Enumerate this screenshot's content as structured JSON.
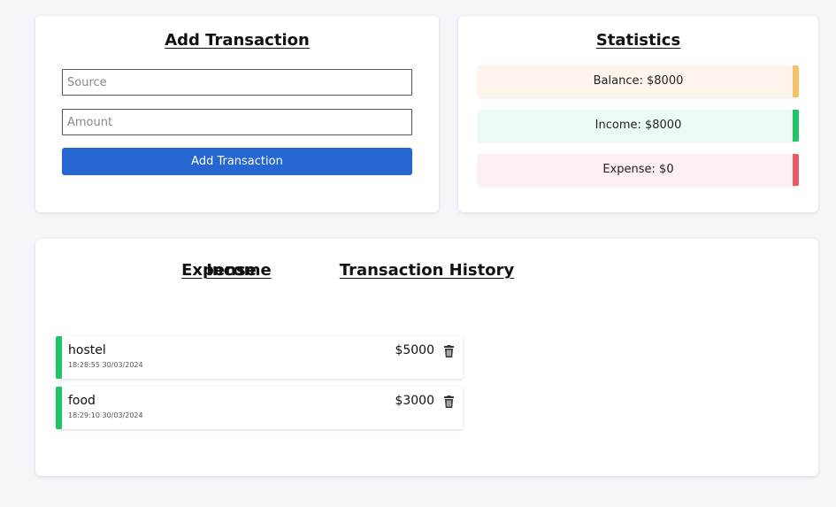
{
  "add_transaction": {
    "title": "Add Transaction",
    "source_placeholder": "Source",
    "amount_placeholder": "Amount",
    "button_label": "Add Transaction"
  },
  "statistics": {
    "title": "Statistics",
    "balance": "Balance: $8000",
    "income": "Income: $8000",
    "expense": "Expense: $0",
    "colors": {
      "balance": "#f5c26a",
      "income": "#22c46a",
      "expense": "#e85a6a"
    }
  },
  "history": {
    "title": "Transaction History",
    "income_title": "Income",
    "expense_title": "Expense",
    "income_items": [
      {
        "source": "hostel",
        "time": "18:28:55 30/03/2024",
        "amount": "$5000",
        "icon": "trash-icon"
      },
      {
        "source": "food",
        "time": "18:29:10 30/03/2024",
        "amount": "$3000",
        "icon": "trash-icon"
      }
    ],
    "expense_items": []
  },
  "colors": {
    "primary_button": "#2666d1",
    "page_background": "#f5f6f9"
  }
}
